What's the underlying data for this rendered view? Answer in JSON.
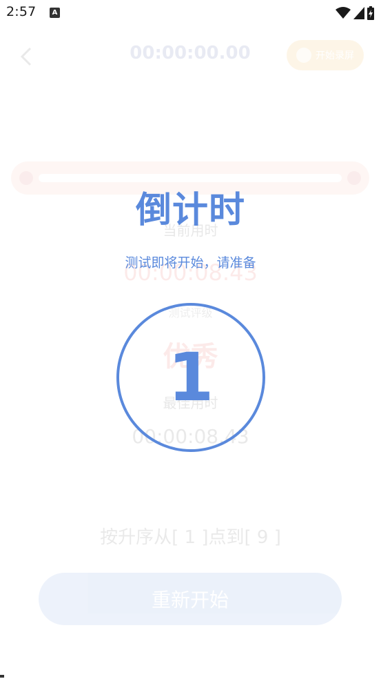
{
  "status_bar": {
    "time": "2:57",
    "notification_icon": "a-notification-icon",
    "icons": [
      "wifi-icon",
      "signal-icon",
      "battery-charging-icon"
    ]
  },
  "background_app": {
    "back_icon": "chevron-left-icon",
    "header_timer": "00:00:00.00",
    "header_pill_label": "开始录屏",
    "current_label": "当前用时",
    "current_value": "00:00:08.43",
    "rank_label": "测试评级",
    "rating": "优秀",
    "best_label": "最佳用时",
    "best_value": "00:00:08.43",
    "instruction": "按升序从[ 1 ]点到[ 9 ]",
    "restart_label": "重新开始"
  },
  "overlay": {
    "title": "倒计时",
    "subtitle": "测试即将开始，请准备",
    "count": "1"
  },
  "colors": {
    "accent": "#5a89dc",
    "danger": "#e53935",
    "pill": "#f5a623"
  }
}
